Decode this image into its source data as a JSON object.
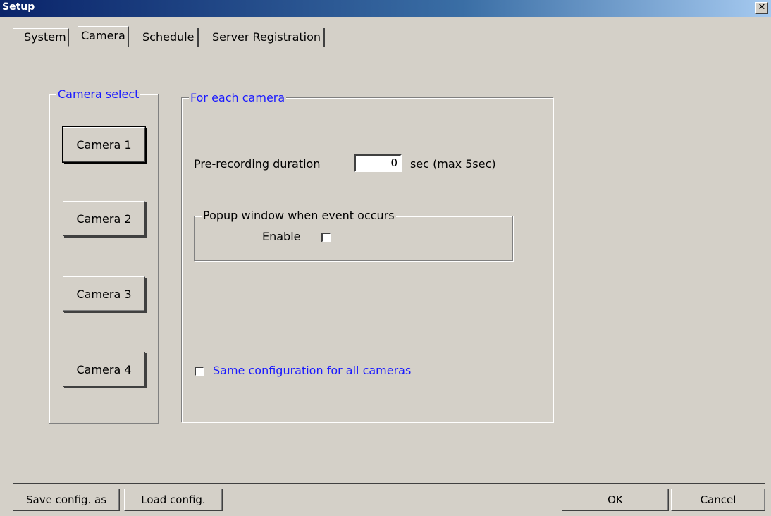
{
  "window": {
    "title": "Setup",
    "close_glyph": "✕"
  },
  "tabs": [
    {
      "label": "System"
    },
    {
      "label": "Camera"
    },
    {
      "label": "Schedule"
    },
    {
      "label": "Server Registration"
    }
  ],
  "active_tab": "Camera",
  "camera_select": {
    "legend": "Camera select",
    "buttons": [
      "Camera 1",
      "Camera 2",
      "Camera 3",
      "Camera 4"
    ],
    "selected": "Camera 1"
  },
  "for_each_camera": {
    "legend": "For each camera",
    "prerec_label": "Pre-recording duration",
    "prerec_value": "0",
    "prerec_unit": "sec (max 5sec)",
    "popup_group": {
      "legend": "Popup window when event occurs",
      "enable_label": "Enable",
      "enable_checked": false
    },
    "same_config_label": "Same configuration for all cameras",
    "same_config_checked": false
  },
  "bottom": {
    "save_label": "Save config. as",
    "load_label": "Load config.",
    "ok_label": "OK",
    "cancel_label": "Cancel"
  },
  "colors": {
    "titlebar": "#0a246a",
    "face": "#d4d0c8",
    "legend_blue": "#1a1aff"
  },
  "icons": {
    "close": "close-icon",
    "checkbox": "checkbox-icon"
  }
}
